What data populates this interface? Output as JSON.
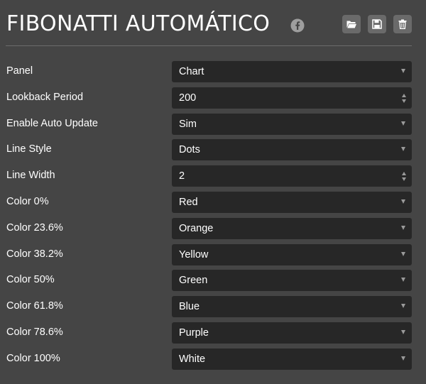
{
  "header": {
    "title": "FIBONATTI AUTOMÁTICO",
    "icons": [
      "facebook-icon",
      "folder-open-icon",
      "save-icon",
      "trash-icon"
    ]
  },
  "colors": {
    "background": "#454545",
    "field_background": "#272727",
    "button_background": "#6a6a6a",
    "text": "#ffffff"
  },
  "settings": [
    {
      "label": "Panel",
      "value": "Chart",
      "control": "select"
    },
    {
      "label": "Lookback Period",
      "value": "200",
      "control": "number"
    },
    {
      "label": "Enable Auto Update",
      "value": "Sim",
      "control": "select"
    },
    {
      "label": "Line Style",
      "value": "Dots",
      "control": "select"
    },
    {
      "label": "Line Width",
      "value": "2",
      "control": "number"
    },
    {
      "label": "Color 0%",
      "value": "Red",
      "control": "select"
    },
    {
      "label": "Color 23.6%",
      "value": "Orange",
      "control": "select"
    },
    {
      "label": "Color 38.2%",
      "value": "Yellow",
      "control": "select"
    },
    {
      "label": "Color 50%",
      "value": "Green",
      "control": "select"
    },
    {
      "label": "Color 61.8%",
      "value": "Blue",
      "control": "select"
    },
    {
      "label": "Color 78.6%",
      "value": "Purple",
      "control": "select"
    },
    {
      "label": "Color 100%",
      "value": "White",
      "control": "select"
    }
  ]
}
